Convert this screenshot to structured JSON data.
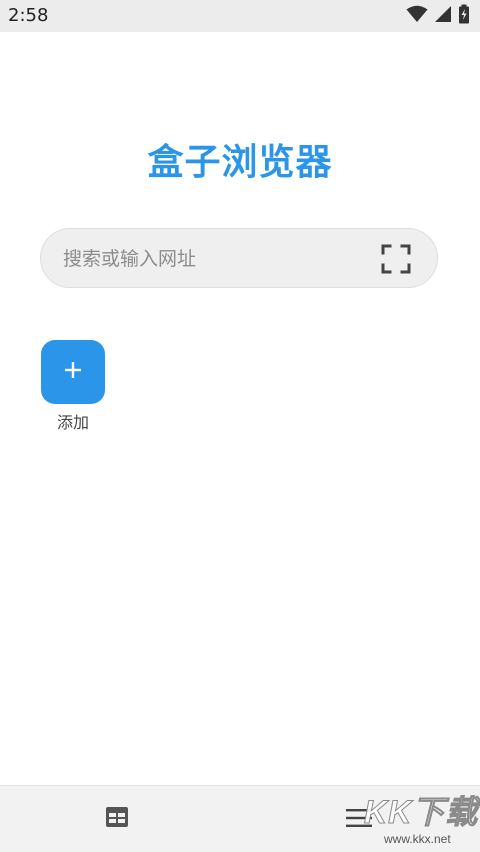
{
  "status_bar": {
    "time": "2:58",
    "icons": [
      "wifi-icon",
      "signal-icon",
      "battery-charging-icon"
    ]
  },
  "app": {
    "title": "盒子浏览器",
    "accent_color": "#2b95ea"
  },
  "search": {
    "placeholder": "搜索或输入网址",
    "scan_icon": "scan-icon"
  },
  "shortcuts": {
    "add_label": "添加",
    "add_icon": "plus-icon"
  },
  "bottom_bar": {
    "tabs_icon": "tabs-icon",
    "menu_icon": "menu-icon"
  },
  "watermark": {
    "main": "KK下载",
    "sub": "www.kkx.net"
  }
}
